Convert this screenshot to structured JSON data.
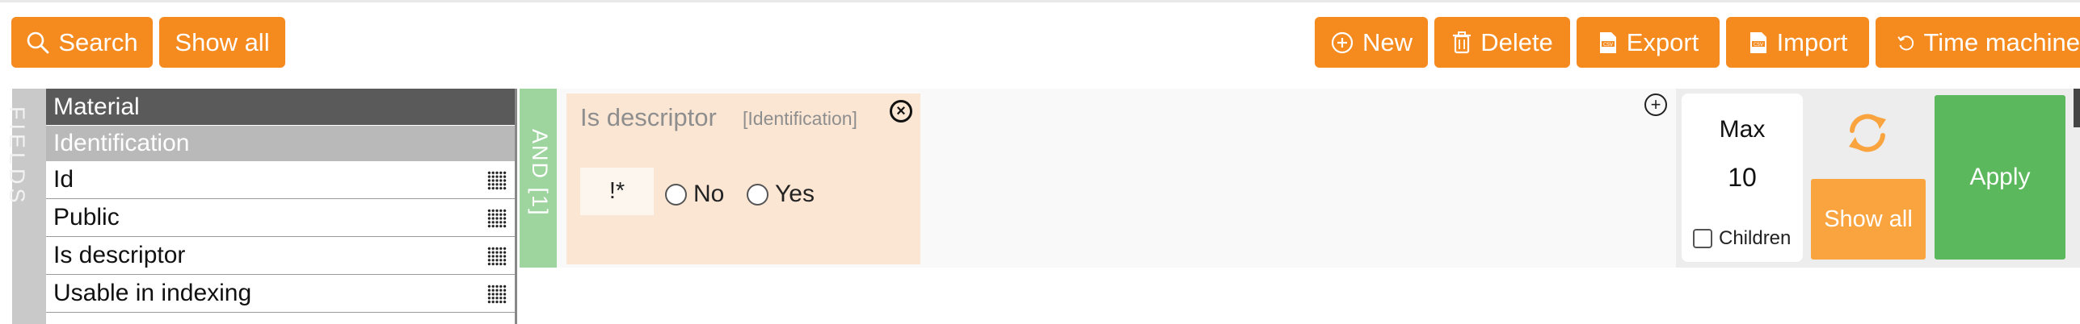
{
  "toolbar": {
    "search_label": "Search",
    "show_all_label": "Show all",
    "new_label": "New",
    "delete_label": "Delete",
    "export_label": "Export",
    "import_label": "Import",
    "time_machine_label": "Time machine"
  },
  "fields_panel": {
    "label": "FIELDS",
    "groups": [
      "Material",
      "Identification"
    ],
    "items": [
      "Id",
      "Public",
      "Is descriptor",
      "Usable in indexing"
    ]
  },
  "logic": {
    "label": "AND [1]"
  },
  "criterion": {
    "title": "Is descriptor",
    "group": "[Identification]",
    "negate_label": "!*",
    "options": [
      "No",
      "Yes"
    ]
  },
  "controls": {
    "max_label": "Max",
    "max_value": "10",
    "children_label": "Children",
    "show_all_label": "Show all",
    "apply_label": "Apply"
  },
  "colors": {
    "accent": "#f58a1f",
    "apply": "#5cb85c",
    "criterion_bg": "#fbe6d4",
    "logic_bg": "#9ed49e"
  },
  "icons": {
    "search": "search-icon",
    "new": "plus-circle-icon",
    "delete": "trash-icon",
    "export": "csv-file-icon",
    "import": "csv-file-icon",
    "time_machine": "history-icon",
    "drag": "grid-icon",
    "remove": "close-circle-icon",
    "add": "plus-circle-icon",
    "refresh": "refresh-icon"
  }
}
